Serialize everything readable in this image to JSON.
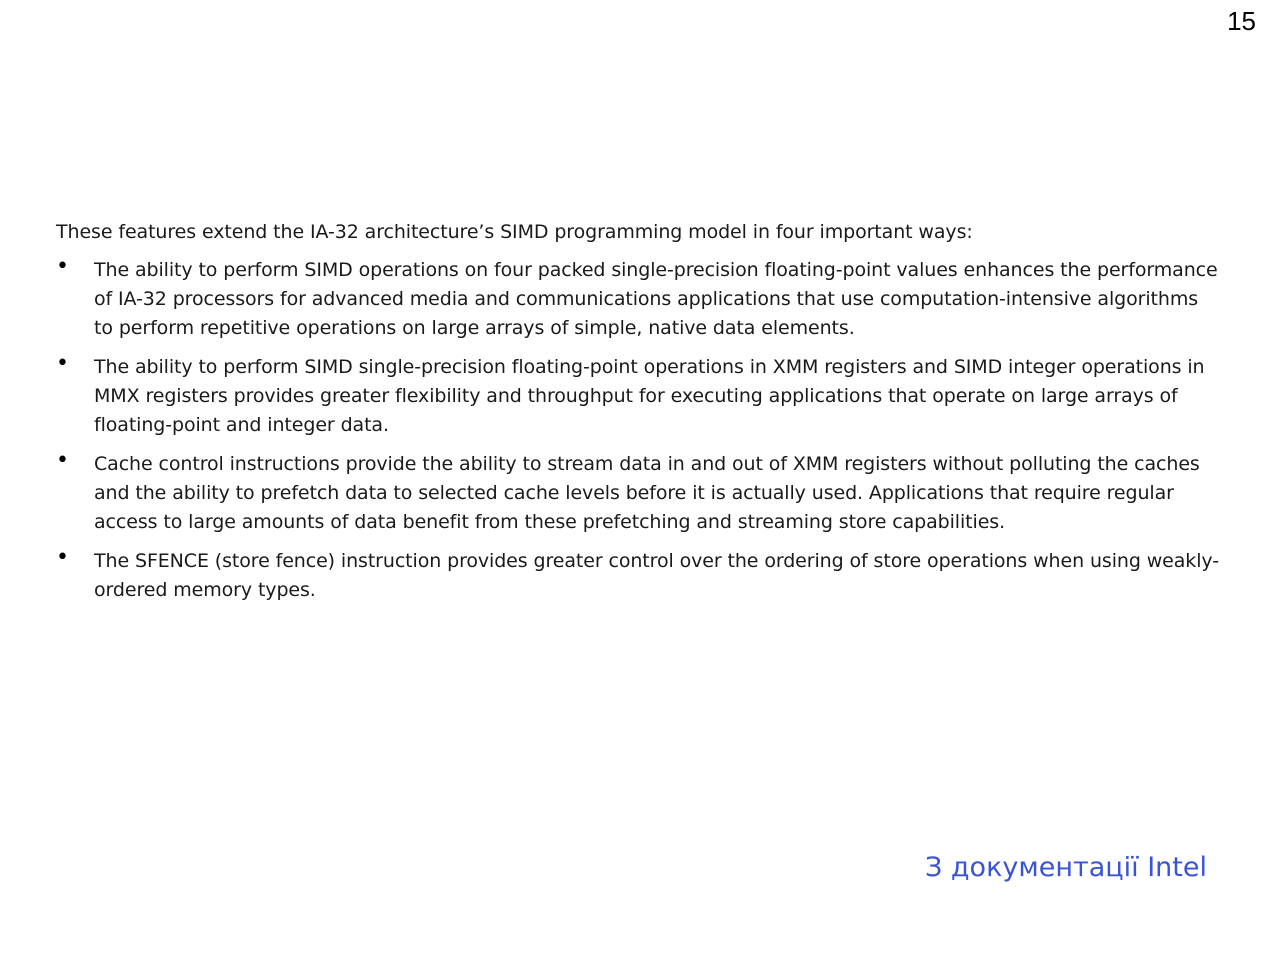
{
  "slide": {
    "number": "15"
  },
  "content": {
    "intro": "These features extend the IA-32 architecture’s SIMD programming model in four important ways:",
    "bullet_symbol": "•",
    "bullets": [
      "The ability to perform SIMD operations on four packed single-precision floating-point values enhances the performance of IA-32 processors for advanced media and communications applications that use computation-intensive algorithms to perform repetitive operations on large arrays of simple, native data elements.",
      "The ability to perform SIMD single-precision floating-point operations in XMM registers and SIMD integer operations in MMX registers provides greater flexibility and throughput for executing applications that operate on large arrays of floating-point and integer data.",
      "Cache control instructions provide the ability to stream data in and out of XMM registers without polluting the caches and the ability to prefetch data to selected cache levels before it is actually used. Applications that require regular access to large amounts of data benefit from these prefetching and streaming store capabilities.",
      "The SFENCE (store fence) instruction provides greater control over the ordering of store operations when using weakly-ordered memory types."
    ]
  },
  "source_note": {
    "text": "З документації Intel",
    "color": "#3a55d4"
  }
}
